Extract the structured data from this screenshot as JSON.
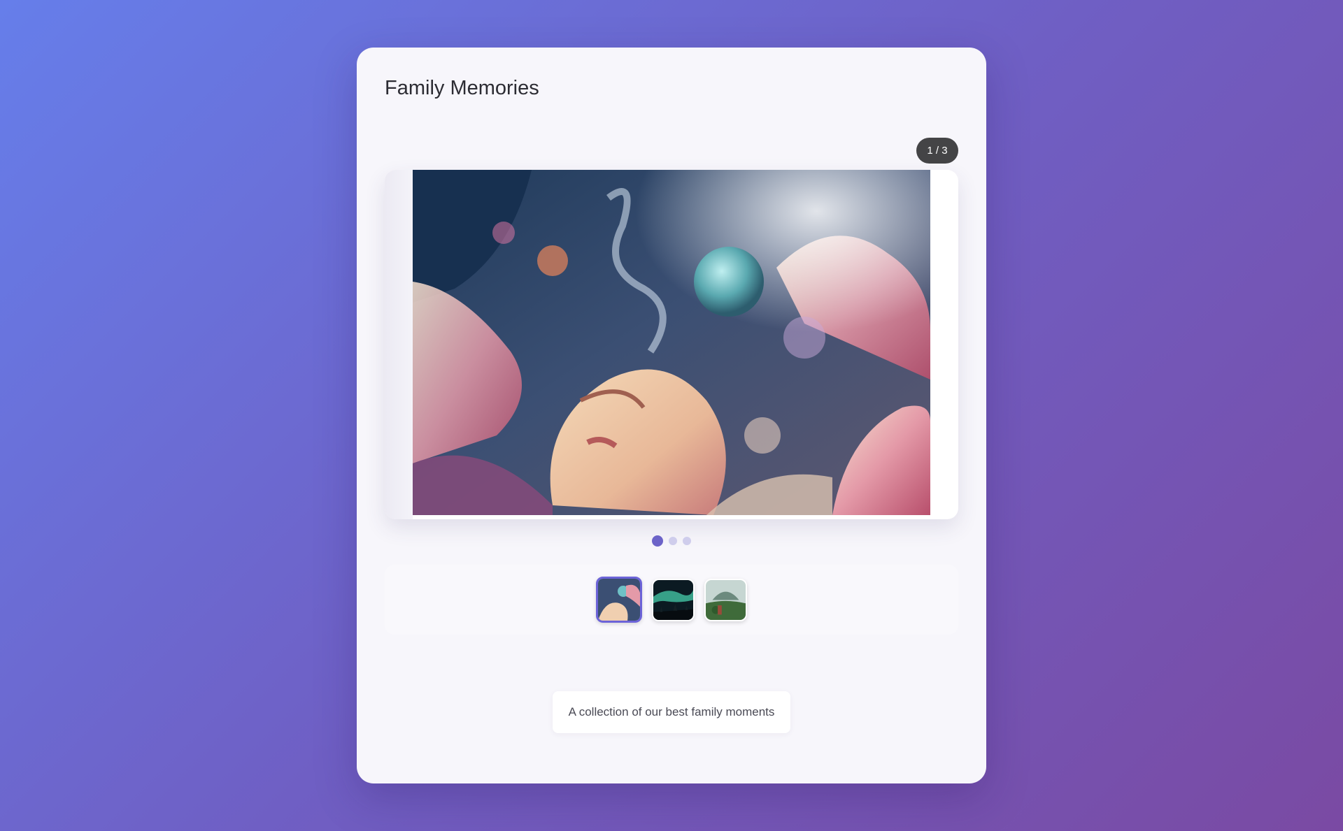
{
  "gallery": {
    "title": "Family Memories",
    "counter": "1 / 3",
    "caption": "A collection of our best family moments",
    "current_index": 1,
    "total": 3,
    "images": [
      {
        "name": "dreaming-face-painting",
        "active": true
      },
      {
        "name": "aurora-night-landscape",
        "active": false
      },
      {
        "name": "mountain-forest-scene",
        "active": false
      }
    ]
  },
  "colors": {
    "accent": "#6c63d8",
    "counter_bg": "#444446",
    "card_bg": "#f7f6fb",
    "page_gradient_start": "#667eea",
    "page_gradient_end": "#7a4aa3"
  }
}
